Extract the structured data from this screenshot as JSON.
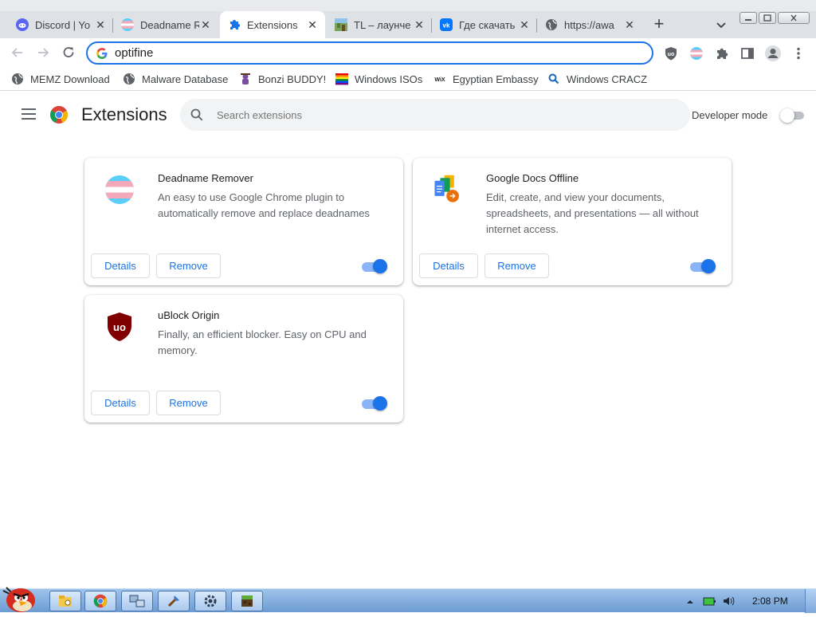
{
  "browser": {
    "tabs": [
      {
        "label": "Discord | Yo",
        "icon": "discord-icon",
        "active": false
      },
      {
        "label": "Deadname R",
        "icon": "trans-flag-icon",
        "active": false
      },
      {
        "label": "Extensions",
        "icon": "puzzle-icon",
        "active": true
      },
      {
        "label": "TL – лаунче",
        "icon": "tl-launcher-icon",
        "active": false
      },
      {
        "label": "Где скачать",
        "icon": "vk-icon",
        "active": false
      },
      {
        "label": "https://awa",
        "icon": "globe-icon",
        "active": false
      }
    ],
    "new_tab_label": "+",
    "omnibox": {
      "value": "optifine",
      "icon": "google-g-icon"
    },
    "bookmarks": [
      {
        "label": "MEMZ Download",
        "icon": "globe-icon"
      },
      {
        "label": "Malware Database",
        "icon": "globe-icon"
      },
      {
        "label": "Bonzi BUDDY!",
        "icon": "bonzi-icon"
      },
      {
        "label": "Windows ISOs",
        "icon": "rainbow-flag-icon"
      },
      {
        "label": "Egyptian Embassy",
        "icon": "wix-icon"
      },
      {
        "label": "Windows CRACZ",
        "icon": "search-icon"
      }
    ]
  },
  "extensions_page": {
    "title": "Extensions",
    "search_placeholder": "Search extensions",
    "developer_mode_label": "Developer mode",
    "developer_mode_enabled": false,
    "cards": [
      {
        "name": "Deadname Remover",
        "description": "An easy to use Google Chrome plugin to automatically remove and replace deadnames",
        "icon": "trans-flag-icon",
        "details_label": "Details",
        "remove_label": "Remove",
        "enabled": true
      },
      {
        "name": "Google Docs Offline",
        "description": "Edit, create, and view your documents, spreadsheets, and presentations — all without internet access.",
        "icon": "google-docs-offline-icon",
        "details_label": "Details",
        "remove_label": "Remove",
        "enabled": true
      },
      {
        "name": "uBlock Origin",
        "description": "Finally, an efficient blocker. Easy on CPU and memory.",
        "icon": "ublock-origin-icon",
        "details_label": "Details",
        "remove_label": "Remove",
        "enabled": true
      }
    ]
  },
  "taskbar": {
    "clock": "2:08 PM",
    "apps": [
      "explorer-icon",
      "chrome-icon",
      "network-icon",
      "tool-icon",
      "settings-icon",
      "minecraft-icon"
    ]
  },
  "colors": {
    "accent": "#1a73e8",
    "toggle_track_on": "#8ab4f8",
    "tab_strip": "#dee1e6",
    "taskbar": "#7fa9dc"
  }
}
